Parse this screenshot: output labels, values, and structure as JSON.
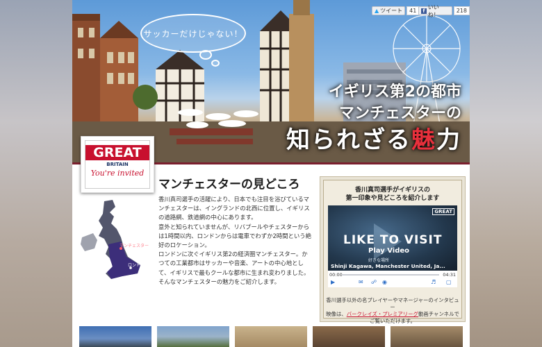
{
  "share": {
    "tweet_label": "ツイート",
    "tweet_count": "41",
    "like_label": "いいね！",
    "like_count": "218"
  },
  "hero": {
    "bubble_text": "サッカーだけじゃない！",
    "tagline_line1": "イギリス第2の都市",
    "tagline_line2": "マンチェスターの",
    "tagline_line3_a": "知られざる",
    "tagline_line3_accent": "魅",
    "tagline_line3_b": "力"
  },
  "badge": {
    "great": "GREAT",
    "britain": "BRITAIN",
    "invited": "You're invited"
  },
  "section": {
    "title": "マンチェスターの見どころ",
    "paragraphs": [
      "香川真司選手の活躍により、日本でも注目を浴びているマンチェスターは、イングランドの北西に位置し、イギリスの道路網、鉄道網の中心にあります。",
      "意外と知られていませんが、リバプールやチェスターからは1時間以内、ロンドンからは電車でわずか2時間という絶好のロケーション。",
      "ロンドンに次ぐイギリス第2の経済圏マンチェスター。かつての工業都市はサッカーや音楽、アートの中心地として、イギリスで最もクールな都市に生まれ変わりました。そんなマンチェスターの魅力をご紹介します。"
    ]
  },
  "map": {
    "label_manchester": "マンチェスター",
    "label_london": "ロンドン"
  },
  "video_panel": {
    "heading_line1": "香川真司選手がイギリスの",
    "heading_line2": "第一印象や見どころを紹介します",
    "video_title": "LIKE TO VISIT",
    "play_label": "Play Video",
    "video_small": "好きな場所",
    "video_caption": "Shinji Kagawa, Manchester United, Ja...",
    "video_badge": "GREAT",
    "time_start": "00:00",
    "time_end": "04:31",
    "footer_line1": "香川選手以外の名プレイヤーやマネージャーのインタビュー",
    "footer_line2_a": "映像は、",
    "footer_link": "バークレイズ・プレミアリーグ",
    "footer_line2_b": "動画チャンネルで",
    "footer_line3": "ご覧いただけます。"
  },
  "colors": {
    "brand_red": "#c8102e",
    "accent_red": "#e8303c",
    "divider": "#7b1f2e"
  }
}
